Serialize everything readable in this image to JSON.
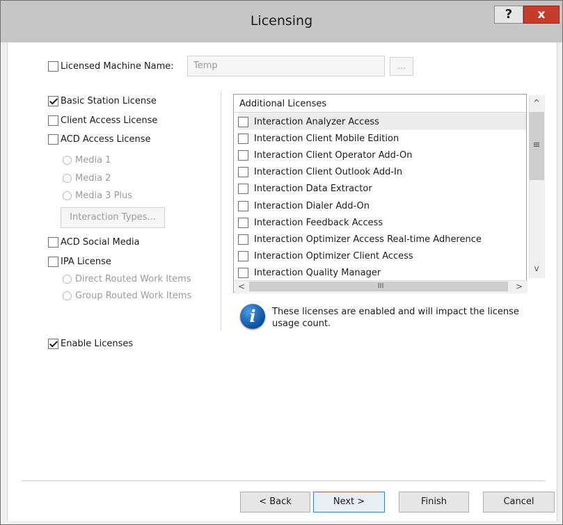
{
  "window": {
    "title": "Licensing",
    "help_label": "?",
    "close_label": "x"
  },
  "machine": {
    "checkbox_label": "Licensed Machine Name:",
    "checked": false,
    "field_value": "Temp",
    "browse_label": "..."
  },
  "licenses": {
    "basic_station": {
      "label": "Basic Station License",
      "checked": true
    },
    "client_access": {
      "label": "Client Access License",
      "checked": false
    },
    "acd_access": {
      "label": "ACD Access License",
      "checked": false
    },
    "media_options": [
      "Media 1",
      "Media 2",
      "Media 3 Plus"
    ],
    "interaction_types_label": "Interaction Types...",
    "acd_social": {
      "label": "ACD Social Media",
      "checked": false
    },
    "ipa": {
      "label": "IPA License",
      "checked": false
    },
    "ipa_options": [
      "Direct Routed Work Items",
      "Group Routed Work Items"
    ],
    "enable": {
      "label": "Enable Licenses",
      "checked": true
    }
  },
  "additional": {
    "header": "Additional Licenses",
    "items": [
      {
        "label": "Interaction Analyzer Access",
        "checked": false,
        "selected": true
      },
      {
        "label": "Interaction Client Mobile Edition",
        "checked": false
      },
      {
        "label": "Interaction Client Operator Add-On",
        "checked": false
      },
      {
        "label": "Interaction Client Outlook Add-In",
        "checked": false
      },
      {
        "label": "Interaction Data Extractor",
        "checked": false
      },
      {
        "label": "Interaction Dialer Add-On",
        "checked": false
      },
      {
        "label": "Interaction Feedback Access",
        "checked": false
      },
      {
        "label": "Interaction Optimizer Access Real-time Adherence",
        "checked": false
      },
      {
        "label": "Interaction Optimizer Client Access",
        "checked": false
      },
      {
        "label": "Interaction Quality Manager",
        "checked": false
      }
    ]
  },
  "scroll": {
    "up": "^",
    "down": "v",
    "left": "<",
    "right": ">",
    "h_grip": "III",
    "v_grip": "≡"
  },
  "info": {
    "icon_glyph": "i",
    "text": "These licenses are enabled and will impact the license usage count."
  },
  "buttons": {
    "back": "< Back",
    "next": "Next >",
    "finish": "Finish",
    "cancel": "Cancel"
  }
}
